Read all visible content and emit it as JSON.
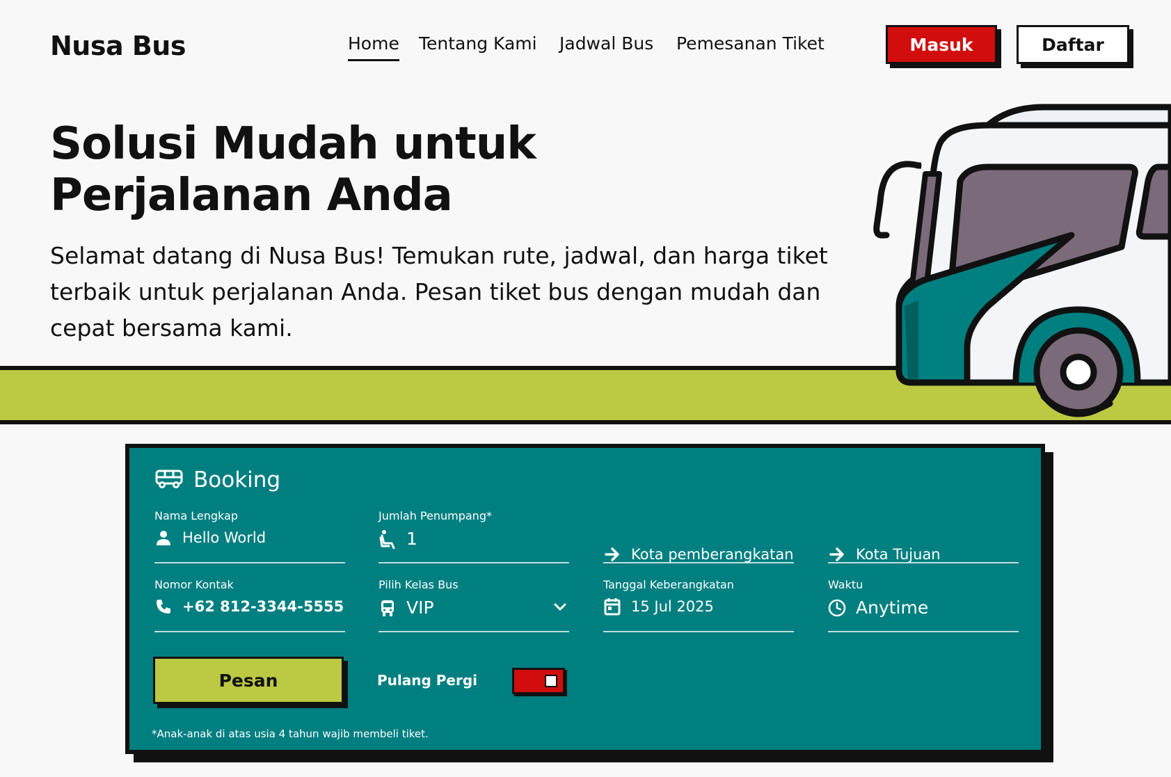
{
  "header": {
    "logo": "Nusa Bus",
    "nav": [
      {
        "label": "Home",
        "active": true
      },
      {
        "label": "Tentang Kami",
        "active": false
      },
      {
        "label": "Jadwal Bus",
        "active": false
      },
      {
        "label": "Pemesanan Tiket",
        "active": false
      }
    ],
    "login_label": "Masuk",
    "register_label": "Daftar"
  },
  "hero": {
    "title_line1": "Solusi Mudah untuk",
    "title_line2": "Perjalanan Anda",
    "description": "Selamat datang di Nusa Bus! Temukan rute, jadwal, dan harga tiket terbaik untuk perjalanan Anda. Pesan tiket bus dengan mudah dan cepat bersama kami."
  },
  "booking": {
    "title": "Booking",
    "title_icon": "bus-icon",
    "fields": {
      "name": {
        "label": "Nama Lengkap",
        "value": "Hello World",
        "icon": "user-icon"
      },
      "passengers": {
        "label": "Jumlah Penumpang*",
        "value": "1",
        "icon": "seat-icon"
      },
      "origin": {
        "placeholder": "Kota pemberangkatan",
        "icon": "arrow-right-icon"
      },
      "destination": {
        "placeholder": "Kota Tujuan",
        "icon": "arrow-right-icon"
      },
      "phone": {
        "label": "Nomor Kontak",
        "value": "+62 812-3344-5555",
        "icon": "phone-icon"
      },
      "bus_class": {
        "label": "Pilih Kelas Bus",
        "value": "VIP",
        "icon": "bus-icon"
      },
      "date": {
        "label": "Tanggal Keberangkatan",
        "value": "15 Jul 2025",
        "icon": "calendar-icon"
      },
      "time": {
        "label": "Waktu",
        "value": "Anytime",
        "icon": "clock-icon"
      }
    },
    "submit_label": "Pesan",
    "round_trip_label": "Pulang Pergi",
    "round_trip_on": true,
    "footnote": "*Anak-anak di atas usia 4 tahun wajib membeli tiket."
  },
  "colors": {
    "accent_red": "#d10d0d",
    "teal": "#007f80",
    "lime": "#bcc943",
    "ink": "#111111"
  }
}
